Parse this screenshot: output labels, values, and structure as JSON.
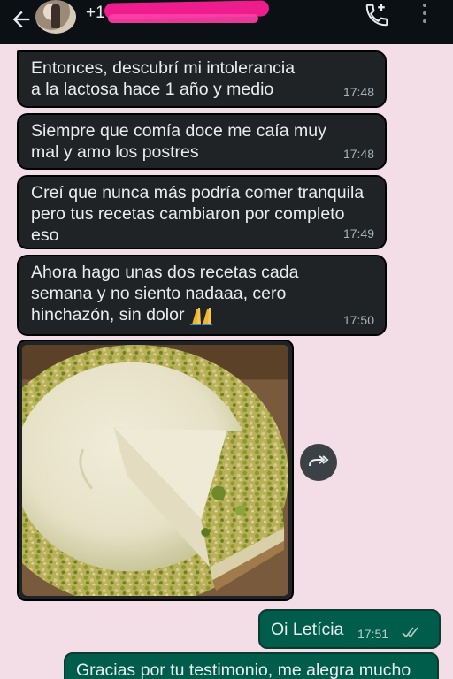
{
  "header": {
    "participant_extra": "+1"
  },
  "messages": [
    {
      "text": "Entonces, descubrí mi intolerancia\na la lactosa hace 1 año y medio",
      "time": "17:48"
    },
    {
      "text": "Siempre que comía doce me caía muy\nmal y amo los postres",
      "time": "17:48"
    },
    {
      "text": "Creí que nunca más podría comer tranquila\npero tus recetas cambiaron por completo\neso",
      "time": "17:49"
    },
    {
      "text_before_emoji": "Ahora hago unas dos recetas cada\nsemana y no siento nadaaa, cero\nhinchazón, sin dolor ",
      "emoji": "folded-hands-emoji",
      "time": "17:50"
    }
  ],
  "image_message": {
    "subject": "pistachio-cheesecake-photo"
  },
  "outgoing": [
    {
      "text": "Oi Letícia",
      "time": "17:51",
      "status": "read"
    },
    {
      "text": "Gracias por tu testimonio, me alegra mucho"
    }
  ],
  "colors": {
    "header_bg": "#0b1014",
    "chat_bg": "#f3dde6",
    "incoming_bubble": "#1f2326",
    "outgoing_bubble": "#005c4b",
    "redaction": "#ee1c8d"
  }
}
